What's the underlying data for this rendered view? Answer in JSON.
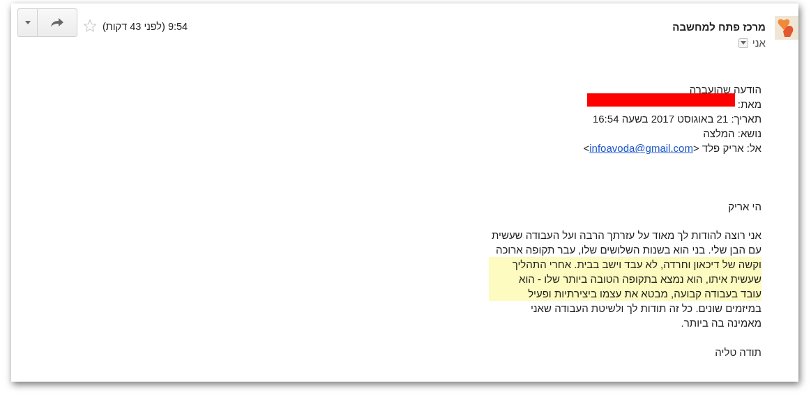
{
  "header": {
    "sender": "מרכז פתח למחשבה",
    "recipient": "אני",
    "time": "9:54 (לפני 43 דקות)",
    "starred": false
  },
  "forwarded": {
    "title": "הודעה שהועברה",
    "from_label": "מאת:",
    "redacted": true,
    "date": "תאריך: 21 באוגוסט 2017 בשעה 16:54",
    "subject": "נושא: המלצה",
    "to_label": "אל: אריק פלד <",
    "to_email": "infoavoda@gmail.com",
    "to_end": ">"
  },
  "greeting": "הי אריק",
  "body_lines": [
    {
      "text": "אני רוצה להודות לך מאוד על עזרתך הרבה ועל העבודה שעשית",
      "highlighted": false
    },
    {
      "text": "עם הבן שלי. בני הוא בשנות השלושים שלו, עבר תקופה ארוכה",
      "highlighted": false
    },
    {
      "text": "וקשה של דיכאון וחרדה, לא עבד וישב בבית. אחרי התהליך",
      "highlighted": true
    },
    {
      "text": "שעשית איתו, הוא נמצא בתקופה הטובה ביותר שלו - הוא",
      "highlighted": true
    },
    {
      "text": "עובד בעבודה קבועה, מבטא את עצמו ביצירתיות ופעיל",
      "highlighted": true
    },
    {
      "text": "במיזמים שונים. כל זה תודות לך ולשיטת העבודה שאני",
      "highlighted": false
    },
    {
      "text": "מאמינה בה ביותר.",
      "highlighted": false
    }
  ],
  "signature": "תודה טליה"
}
